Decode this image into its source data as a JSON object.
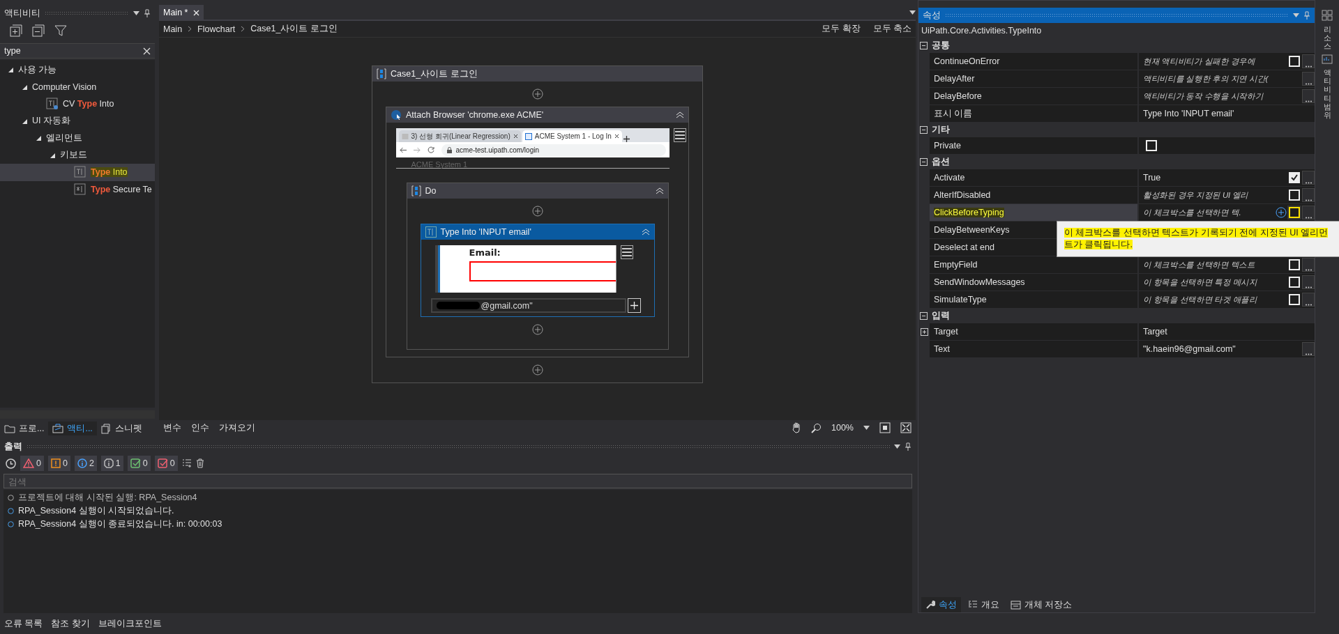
{
  "activities_panel": {
    "title": "액티비티",
    "search": {
      "value": "type"
    },
    "tree": [
      {
        "label": "사용 가능",
        "expanded": true,
        "selected": false,
        "children": [
          {
            "label": "Computer Vision",
            "expanded": true,
            "selected": false,
            "children": [
              {
                "kind": "cv-type-into",
                "before": "CV ",
                "match": "Type",
                "after": " Into",
                "selected": false
              }
            ]
          },
          {
            "label": "UI 자동화",
            "expanded": true,
            "selected": false,
            "children": [
              {
                "label": "엘리먼트",
                "expanded": true,
                "selected": false,
                "children": [
                  {
                    "label": "키보드",
                    "expanded": true,
                    "selected": false,
                    "children": [
                      {
                        "kind": "type-into",
                        "match": "Type",
                        "after": " Into",
                        "selected": true
                      },
                      {
                        "kind": "type-secure",
                        "match": "Type",
                        "after": " Secure Te",
                        "selected": false
                      }
                    ]
                  }
                ]
              }
            ]
          }
        ]
      }
    ],
    "bottom_tabs": [
      {
        "kind": "project",
        "label": "프로...",
        "selected": false
      },
      {
        "kind": "activities",
        "label": "액티...",
        "selected": true
      },
      {
        "kind": "snippets",
        "label": "스니펫",
        "selected": false
      }
    ]
  },
  "designer": {
    "tabs": [
      {
        "label": "Main *",
        "selected": true
      }
    ],
    "breadcrumb": [
      "Main",
      "Flowchart",
      "Case1_사이트 로그인"
    ],
    "actions": [
      "모두 확장",
      "모두 축소"
    ],
    "canvas": {
      "title": "Case1_사이트 로그인",
      "selected": false,
      "attach": {
        "title": "Attach Browser 'chrome.exe ACME'",
        "selected": false,
        "browser": {
          "tabs": [
            {
              "title": "3) 선형 회귀(Linear Regression)",
              "selected": false
            },
            {
              "title": "ACME System 1 - Log In",
              "selected": true
            }
          ],
          "url": "acme-test.uipath.com/login",
          "page_heading": "ACME System 1"
        },
        "do": {
          "title": "Do",
          "selected": false,
          "activity": {
            "title": "Type Into 'INPUT  email'",
            "selected": true,
            "screenshot_label": "Email:",
            "text_value": "@gmail.com\""
          }
        }
      }
    },
    "bottom_tabs": [
      "변수",
      "인수",
      "가져오기"
    ],
    "zoom": "100%"
  },
  "output": {
    "title": "출력",
    "filters": [
      {
        "kind": "error",
        "count": "0"
      },
      {
        "kind": "warning",
        "count": "0"
      },
      {
        "kind": "info",
        "count": "2"
      },
      {
        "kind": "trace",
        "count": "1"
      },
      {
        "kind": "success",
        "count": "0"
      },
      {
        "kind": "failure",
        "count": "0"
      }
    ],
    "search": {
      "placeholder": "검색"
    },
    "lines": [
      {
        "kind": "trace",
        "text": "프로젝트에 대해 시작된 실행: RPA_Session4"
      },
      {
        "kind": "info",
        "text": "RPA_Session4 실행이 시작되었습니다."
      },
      {
        "kind": "info",
        "text": "RPA_Session4 실행이 종료되었습니다. in: 00:00:03"
      }
    ]
  },
  "status_bar": [
    "오류 목록",
    "참조 찾기",
    "브레이크포인트"
  ],
  "properties": {
    "title": "속성",
    "type_name": "UiPath.Core.Activities.TypeInto",
    "categories": [
      {
        "name": "공통",
        "expanded": true,
        "rows": [
          {
            "name": "ContinueOnError",
            "kind": "hint-check",
            "placeholder": "현재 액티비티가 실패한 경우에",
            "checked": false,
            "selected": false
          },
          {
            "name": "DelayAfter",
            "kind": "hint",
            "placeholder": "액티비티를 실행한 후의 지연 시간(",
            "selected": false
          },
          {
            "name": "DelayBefore",
            "kind": "hint",
            "placeholder": "액티비티가 동작 수행을 시작하기",
            "selected": false
          },
          {
            "name": "표시 이름",
            "kind": "value",
            "value": "Type Into 'INPUT  email'",
            "selected": false
          }
        ]
      },
      {
        "name": "기타",
        "expanded": true,
        "rows": [
          {
            "name": "Private",
            "kind": "check",
            "checked": false,
            "selected": false
          }
        ]
      },
      {
        "name": "옵션",
        "expanded": true,
        "rows": [
          {
            "name": "Activate",
            "kind": "value-check",
            "value": "True",
            "checked": true,
            "selected": false
          },
          {
            "name": "AlterIfDisabled",
            "kind": "hint-check",
            "placeholder": "활성화된 경우 지정된 UI 엘리",
            "checked": false,
            "selected": false
          },
          {
            "name": "ClickBeforeTyping",
            "kind": "hint-check",
            "placeholder": "이 체크박스를 선택하면 텍.",
            "checked": false,
            "selected": true
          },
          {
            "name": "DelayBetweenKeys",
            "kind": "covered",
            "selected": false
          },
          {
            "name": "Deselect at end",
            "kind": "covered",
            "selected": false
          },
          {
            "name": "EmptyField",
            "kind": "hint-check",
            "placeholder": "이 체크박스를 선택하면 텍스트",
            "checked": false,
            "selected": false
          },
          {
            "name": "SendWindowMessages",
            "kind": "hint-check",
            "placeholder": "이 항목을 선택하면 특정 메시지",
            "checked": false,
            "selected": false
          },
          {
            "name": "SimulateType",
            "kind": "hint-check",
            "placeholder": "이 항목을 선택하면 타겟 애플리",
            "checked": false,
            "selected": false
          }
        ]
      },
      {
        "name": "입력",
        "expanded": true,
        "rows": [
          {
            "name": "Target",
            "kind": "expandable",
            "value": "Target",
            "expanded": false,
            "selected": false
          },
          {
            "name": "Text",
            "kind": "text",
            "value": "\"k.haein96@gmail.com\"",
            "selected": false
          }
        ]
      }
    ],
    "tooltip": "이 체크박스를 선택하면 텍스트가 기록되기 전에 지정된 UI 엘리먼트가 클릭됩니다.",
    "bottom_tabs": [
      {
        "kind": "properties",
        "label": "속성",
        "selected": true
      },
      {
        "kind": "outline",
        "label": "개요",
        "selected": false
      },
      {
        "kind": "repository",
        "label": "개체 저장소",
        "selected": false
      }
    ]
  },
  "side_strip": [
    {
      "kind": "resources",
      "label": "리소스"
    },
    {
      "kind": "scope",
      "label": "액티비티 범위"
    }
  ]
}
